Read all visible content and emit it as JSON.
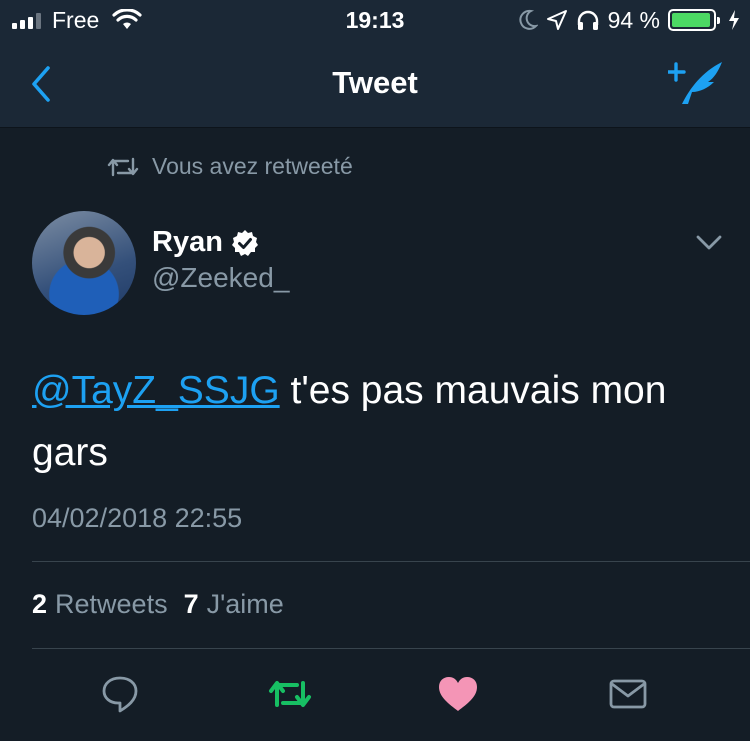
{
  "status_bar": {
    "carrier": "Free",
    "time": "19:13",
    "battery_percent": "94 %",
    "battery_level": 0.94,
    "icons": [
      "signal-icon",
      "wifi-icon",
      "moon-icon",
      "location-icon",
      "headphones-icon",
      "battery-icon",
      "charging-icon"
    ]
  },
  "nav": {
    "title": "Tweet",
    "back_icon": "back-chevron-icon",
    "compose_icon": "compose-tweet-icon"
  },
  "tweet": {
    "retweet_context": "Vous avez retweeté",
    "author": {
      "name": "Ryan",
      "handle": "@Zeeked_",
      "verified": true
    },
    "text": {
      "mention": "@TayZ_SSJG",
      "body": " t'es pas mauvais mon gars"
    },
    "timestamp": "04/02/2018 22:55",
    "stats": {
      "retweets_count": "2",
      "retweets_label": "Retweets",
      "likes_count": "7",
      "likes_label": "J'aime"
    }
  },
  "actions": [
    {
      "name": "reply",
      "icon": "reply-icon"
    },
    {
      "name": "retweet",
      "icon": "retweet-icon",
      "active": true,
      "color": "#17bf63"
    },
    {
      "name": "like",
      "icon": "heart-icon",
      "active": true,
      "color": "#e0245e"
    },
    {
      "name": "message",
      "icon": "envelope-icon"
    }
  ],
  "colors": {
    "background": "#141d26",
    "bar": "#1b2836",
    "accent": "#1da1f2",
    "secondary_text": "#8899a6",
    "retweet_green": "#17bf63",
    "like_pink": "#f495b6"
  }
}
